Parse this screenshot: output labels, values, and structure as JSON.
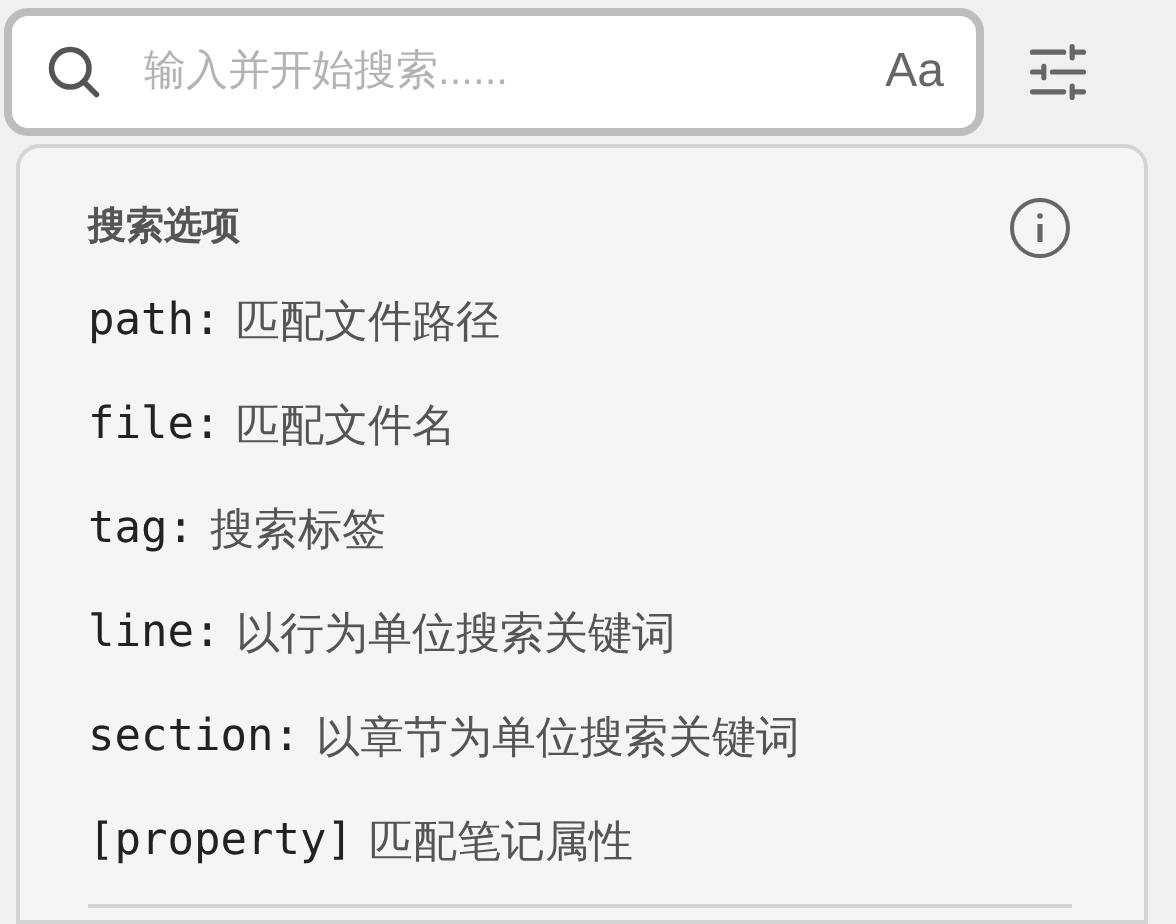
{
  "search": {
    "placeholder": "输入并开始搜索......",
    "case_toggle": "Aa"
  },
  "options_panel": {
    "title": "搜索选项",
    "options": [
      {
        "keyword": "path:",
        "description": "匹配文件路径"
      },
      {
        "keyword": "file:",
        "description": "匹配文件名"
      },
      {
        "keyword": "tag:",
        "description": "搜索标签"
      },
      {
        "keyword": "line:",
        "description": "以行为单位搜索关键词"
      },
      {
        "keyword": "section:",
        "description": "以章节为单位搜索关键词"
      },
      {
        "keyword": "[property]",
        "description": "匹配笔记属性"
      }
    ]
  }
}
